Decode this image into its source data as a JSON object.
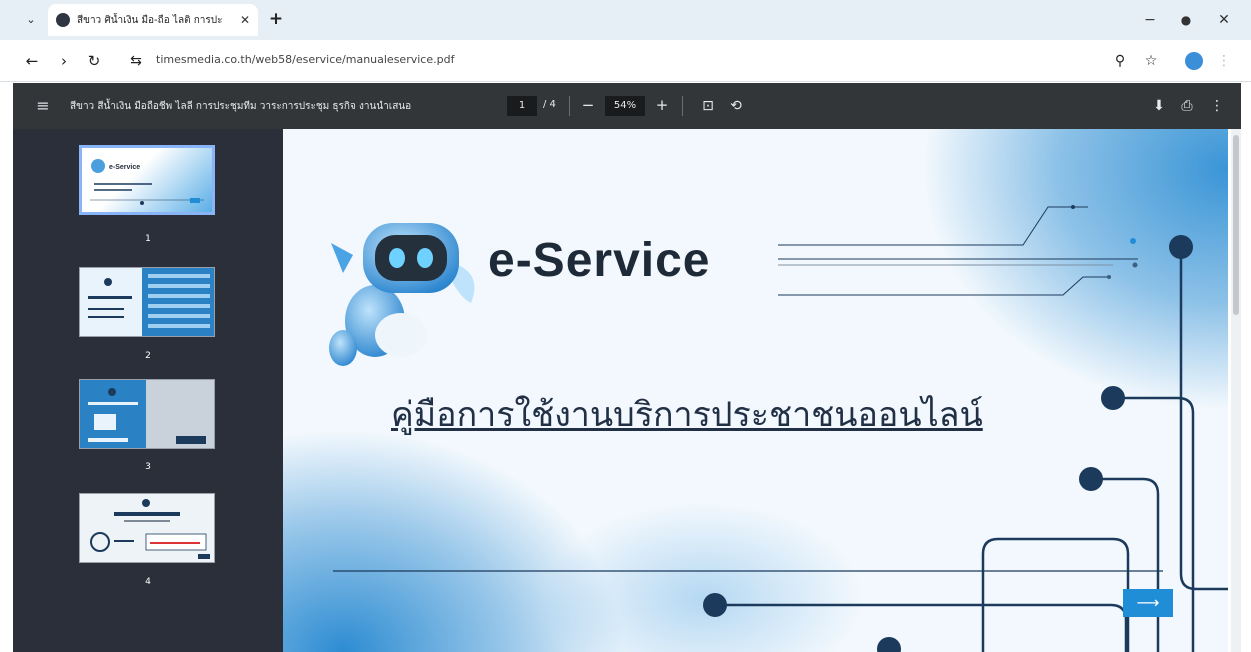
{
  "tab": {
    "title": "สีขาว ศิน้ำเงิน มือ-ถือ ไลติ การปะ",
    "close_glyph": "✕",
    "chevron_glyph": "⌄",
    "new_tab_glyph": "+"
  },
  "window": {
    "minimize_glyph": "−",
    "restore_glyph": "●",
    "close_glyph": "✕"
  },
  "nav": {
    "back_glyph": "←",
    "forward_glyph": "›",
    "reload_glyph": "↻"
  },
  "address": {
    "site_info_glyph": "⇆",
    "url": "timesmedia.co.th/web58/eservice/manualeservice.pdf",
    "zoom_glyph": "⚲",
    "bookmark_glyph": "☆",
    "kebab_glyph": "⋮"
  },
  "pdf_toolbar": {
    "menu_glyph": "≡",
    "title": "สีขาว สีน้ำเงิน มือถือชีพ ไลลี การประชุมทีม วาระการประชุม ธุรกิจ งานนำเสนอ",
    "page_current": "1",
    "page_total": "/ 4",
    "zoom_out_glyph": "−",
    "zoom_value": "54%",
    "zoom_in_glyph": "+",
    "fit_glyph": "⊡",
    "rotate_glyph": "⟲",
    "download_glyph": "⬇",
    "print_glyph": "⎙",
    "more_glyph": "⋮"
  },
  "thumbnails": [
    {
      "number": "1",
      "caption": "e-Service"
    },
    {
      "number": "2"
    },
    {
      "number": "3"
    },
    {
      "number": "4"
    }
  ],
  "slide": {
    "heading": "e-Service",
    "subtitle": "คู่มือการใช้งานบริการประชาชนออนไลน์",
    "arrow_glyph": "⟶"
  },
  "colors": {
    "accent": "#1f8ed6",
    "navy": "#1b3a5c",
    "toolbar": "#323639",
    "sidebar": "#2b2f3a"
  },
  "icons": [
    "chevron-down-icon",
    "globe-icon",
    "close-icon",
    "plus-icon",
    "minimize-icon",
    "restore-icon",
    "back-arrow-icon",
    "forward-arrow-icon",
    "reload-icon",
    "site-info-icon",
    "zoom-icon",
    "bookmark-star-icon",
    "menu-icon",
    "fit-page-icon",
    "rotate-icon",
    "download-icon",
    "print-icon",
    "more-vert-icon",
    "arrow-right-icon",
    "robot-mascot-icon"
  ]
}
